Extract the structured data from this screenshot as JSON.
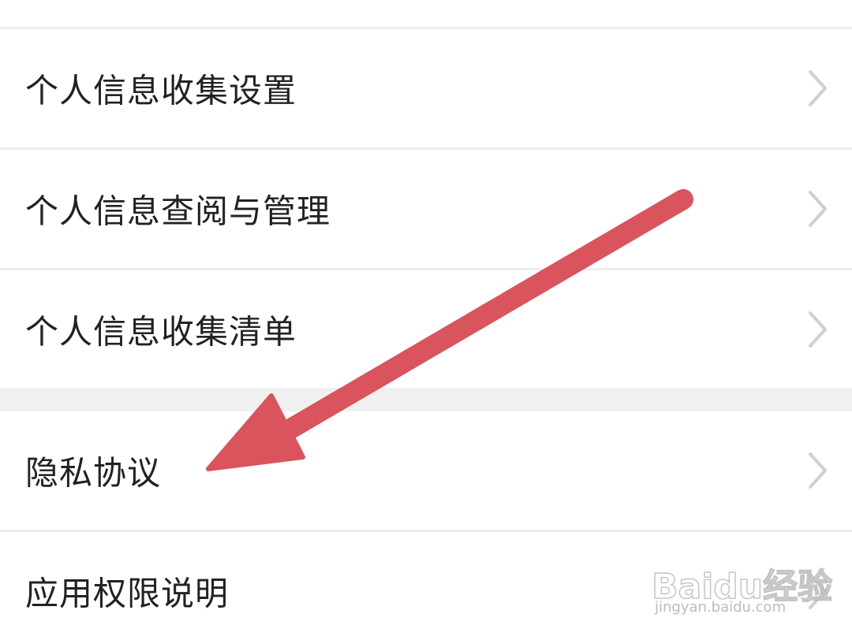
{
  "settings_list": {
    "items": [
      {
        "label": "个人信息收集设置"
      },
      {
        "label": "个人信息查阅与管理"
      },
      {
        "label": "个人信息收集清单"
      },
      {
        "label": "隐私协议"
      },
      {
        "label": "应用权限说明"
      }
    ]
  },
  "annotation": {
    "arrow_color": "#d9545d",
    "points_to": "隐私协议"
  },
  "watermark": {
    "brand": "Baidu经验",
    "url": "jingyan.baidu.com"
  },
  "icons": {
    "row_chevron": "chevron-right-icon",
    "annotation_arrow": "arrow-icon"
  }
}
